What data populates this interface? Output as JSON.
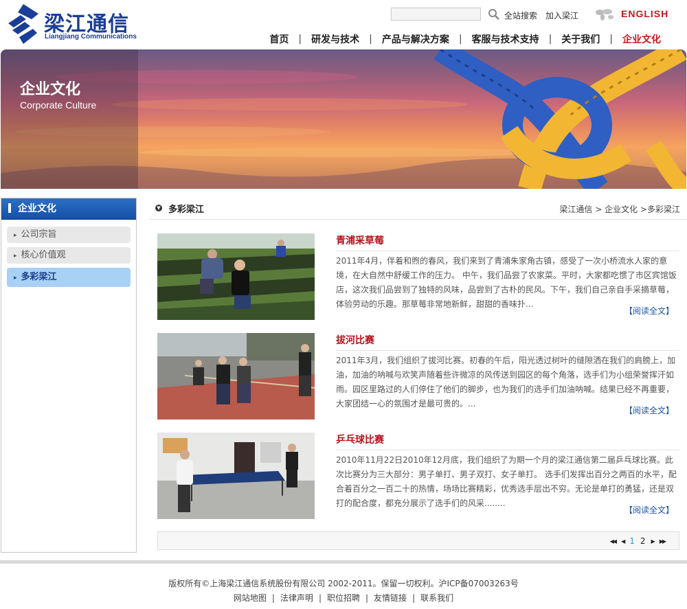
{
  "header": {
    "logo_cn": "梁江通信",
    "logo_en": "Liangjiang Communications",
    "search_link": "全站搜索",
    "join_link": "加入梁江",
    "english_link": "ENGLISH"
  },
  "nav": {
    "items": [
      {
        "label": "首页"
      },
      {
        "label": "研发与技术"
      },
      {
        "label": "产品与解决方案"
      },
      {
        "label": "客服与技术支持"
      },
      {
        "label": "关于我们"
      },
      {
        "label": "企业文化"
      }
    ],
    "separator": "|"
  },
  "banner": {
    "title": "企业文化",
    "subtitle": "Corporate Culture"
  },
  "sidebar": {
    "title": "企业文化",
    "items": [
      {
        "label": "公司宗旨"
      },
      {
        "label": "核心价值观"
      },
      {
        "label": "多彩梁江"
      }
    ],
    "arrow": "▸"
  },
  "main": {
    "title": "多彩梁江",
    "breadcrumb": {
      "home": "梁江通信",
      "sep1": " > ",
      "section": "企业文化",
      "sep2": " >",
      "current": "多彩梁江"
    },
    "articles": [
      {
        "title": "青浦采草莓",
        "text": "2011年4月，伴着和煦的春风，我们来到了青浦朱家角古镇，感受了一次小桥流水人家的意境，在大自然中舒缓工作的压力。 中午，我们品尝了农家菜。平时，大家都吃惯了市区宾馆饭店，这次我们品尝到了独特的风味，品尝到了古朴的民风。下午，我们自己亲自手采摘草莓，体验劳动的乐趣。那草莓非常地新鲜，甜甜的香味扑...",
        "more": "【阅读全文】"
      },
      {
        "title": "拔河比赛",
        "text": "2011年3月，我们组织了拔河比赛。初春的午后，阳光透过树叶的缝隙洒在我们的肩膀上，加油，加油的呐喊与欢笑声随着些许微凉的风传送到园区的每个角落，选手们为小组荣誉挥汗如雨。园区里路过的人们停住了他们的脚步，也为我们的选手们加油呐喊。结果已经不再重要，大家团结一心的氛围才是最可贵的。...",
        "more": "【阅读全文】"
      },
      {
        "title": "乒乓球比赛",
        "text": "2010年11月22日2010年12月底，我们组织了为期一个月的梁江通信第二届乒乓球比赛。此次比赛分为三大部分：男子单打、男子双打、女子单打。 选手们发挥出百分之两百的水平，配合着百分之一百二十的热情，场场比赛精彩，优秀选手层出不穷。无论是单打的勇猛，还是双打的配合度，都充分展示了选手们的风采........",
        "more": "【阅读全文】"
      }
    ]
  },
  "pager": {
    "first": "◀◀",
    "prev": "◀",
    "pages": [
      "1",
      "2"
    ],
    "current_page": "1",
    "next": "▶",
    "last": "▶▶"
  },
  "footer": {
    "copyright": "版权所有©上海梁江通信系统股份有限公司  2002-2011。保留一切权利。沪ICP备07003263号",
    "links": [
      {
        "label": "网站地图"
      },
      {
        "label": "法律声明"
      },
      {
        "label": "职位招聘"
      },
      {
        "label": "友情链接"
      },
      {
        "label": "联系我们"
      }
    ],
    "separator": "|"
  },
  "colors": {
    "brand_blue": "#1a3e97",
    "accent_red": "#c8161d",
    "sidebar_head": "#1f5fb8",
    "link_blue": "#1a55a8"
  }
}
